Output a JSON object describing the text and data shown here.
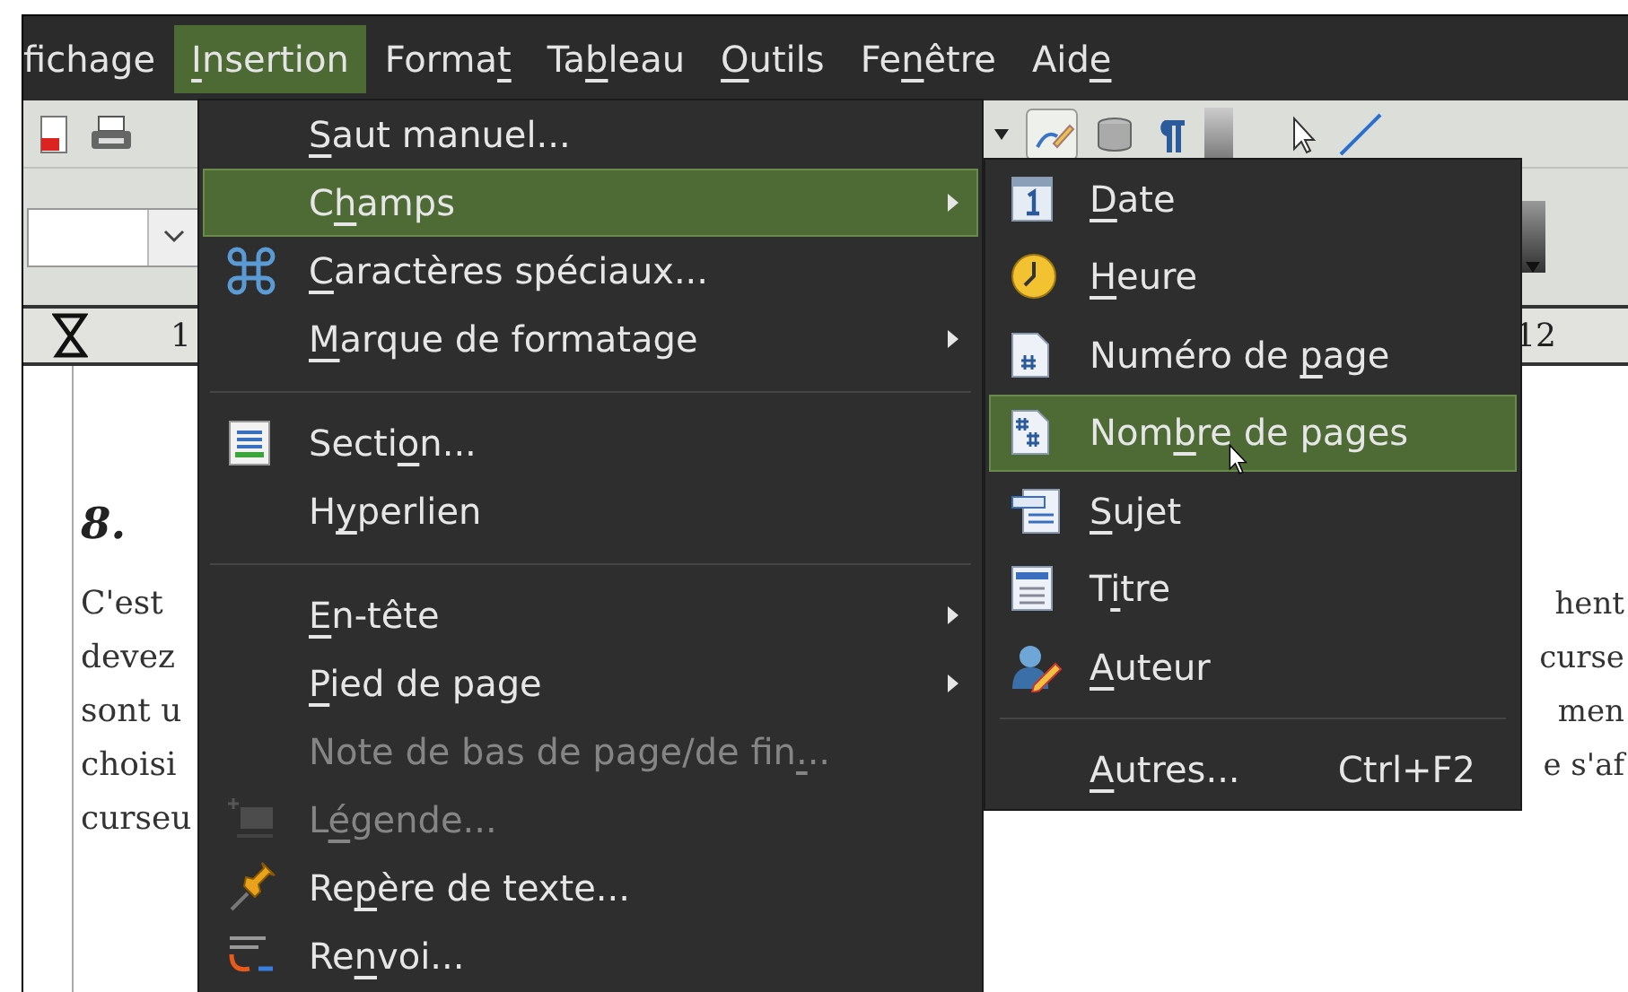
{
  "menubar": [
    {
      "label": [
        {
          "text": "fichage"
        }
      ],
      "selected": false
    },
    {
      "label": [
        {
          "text": "I",
          "underlined": true
        },
        {
          "text": "nsertion"
        }
      ],
      "selected": true
    },
    {
      "label": [
        {
          "text": "Forma"
        },
        {
          "text": "t",
          "underlined": true
        }
      ],
      "selected": false
    },
    {
      "label": [
        {
          "text": "Ta"
        },
        {
          "text": "b",
          "underlined": true
        },
        {
          "text": "leau"
        }
      ],
      "selected": false
    },
    {
      "label": [
        {
          "text": "O",
          "underlined": true
        },
        {
          "text": "utils"
        }
      ],
      "selected": false
    },
    {
      "label": [
        {
          "text": "Fe"
        },
        {
          "text": "n",
          "underlined": true
        },
        {
          "text": "être"
        }
      ],
      "selected": false
    },
    {
      "label": [
        {
          "text": "Aid"
        },
        {
          "text": "e",
          "underlined": true
        }
      ],
      "selected": false
    }
  ],
  "ruler": {
    "labels": [
      "1",
      "12"
    ]
  },
  "document": {
    "heading": "8.",
    "left_lines": [
      "C'est",
      "devez",
      "sont u",
      "choisi",
      "curseu"
    ],
    "right_lines": [
      "hent",
      "curse",
      "men",
      "e s'af"
    ]
  },
  "insert_menu": {
    "items": [
      {
        "kind": "item",
        "label": [
          {
            "text": "S",
            "underlined": true
          },
          {
            "text": "aut manuel..."
          }
        ],
        "selected": false,
        "disabled": false,
        "submenu": false
      },
      {
        "kind": "item",
        "label": [
          {
            "text": "C"
          },
          {
            "text": "h",
            "underlined": true
          },
          {
            "text": "amps"
          }
        ],
        "selected": true,
        "disabled": false,
        "submenu": true
      },
      {
        "kind": "item",
        "label": [
          {
            "text": "C",
            "underlined": true
          },
          {
            "text": "aractères spéciaux..."
          }
        ],
        "selected": false,
        "disabled": false,
        "submenu": false
      },
      {
        "kind": "item",
        "label": [
          {
            "text": "M",
            "underlined": true
          },
          {
            "text": "arque de formatage"
          }
        ],
        "selected": false,
        "disabled": false,
        "submenu": true
      },
      {
        "kind": "separator"
      },
      {
        "kind": "item",
        "label": [
          {
            "text": "Secti"
          },
          {
            "text": "o",
            "underlined": true
          },
          {
            "text": "n..."
          }
        ],
        "selected": false,
        "disabled": false,
        "submenu": false
      },
      {
        "kind": "item",
        "label": [
          {
            "text": "H"
          },
          {
            "text": "y",
            "underlined": true
          },
          {
            "text": "perlien"
          }
        ],
        "selected": false,
        "disabled": false,
        "submenu": false
      },
      {
        "kind": "separator"
      },
      {
        "kind": "item",
        "label": [
          {
            "text": "E",
            "underlined": true
          },
          {
            "text": "n-tête"
          }
        ],
        "selected": false,
        "disabled": false,
        "submenu": true
      },
      {
        "kind": "item",
        "label": [
          {
            "text": "P",
            "underlined": true
          },
          {
            "text": "ied de page"
          }
        ],
        "selected": false,
        "disabled": false,
        "submenu": true
      },
      {
        "kind": "item",
        "label": [
          {
            "text": "Note de bas de page/de fin"
          },
          {
            "text": ".",
            "underlined": true
          },
          {
            "text": ".."
          }
        ],
        "selected": false,
        "disabled": true,
        "submenu": false
      },
      {
        "kind": "item",
        "label": [
          {
            "text": "L"
          },
          {
            "text": "é",
            "underlined": true
          },
          {
            "text": "gende..."
          }
        ],
        "selected": false,
        "disabled": true,
        "submenu": false
      },
      {
        "kind": "item",
        "label": [
          {
            "text": "Re"
          },
          {
            "text": "p",
            "underlined": true
          },
          {
            "text": "ère de texte..."
          }
        ],
        "selected": false,
        "disabled": false,
        "submenu": false
      },
      {
        "kind": "item",
        "label": [
          {
            "text": "Re"
          },
          {
            "text": "n",
            "underlined": true
          },
          {
            "text": "voi..."
          }
        ],
        "selected": false,
        "disabled": false,
        "submenu": false
      }
    ]
  },
  "fields_submenu": {
    "items": [
      {
        "kind": "item",
        "label": [
          {
            "text": "D",
            "underlined": true
          },
          {
            "text": "ate"
          }
        ],
        "selected": false
      },
      {
        "kind": "item",
        "label": [
          {
            "text": "H",
            "underlined": true
          },
          {
            "text": "eure"
          }
        ],
        "selected": false
      },
      {
        "kind": "item",
        "label": [
          {
            "text": "Numéro de "
          },
          {
            "text": "p",
            "underlined": true
          },
          {
            "text": "age"
          }
        ],
        "selected": false
      },
      {
        "kind": "item",
        "label": [
          {
            "text": "Nom"
          },
          {
            "text": "b",
            "underlined": true
          },
          {
            "text": "re de pages"
          }
        ],
        "selected": true
      },
      {
        "kind": "item",
        "label": [
          {
            "text": "S",
            "underlined": true
          },
          {
            "text": "ujet"
          }
        ],
        "selected": false
      },
      {
        "kind": "item",
        "label": [
          {
            "text": "T"
          },
          {
            "text": "i",
            "underlined": true
          },
          {
            "text": "tre"
          }
        ],
        "selected": false
      },
      {
        "kind": "item",
        "label": [
          {
            "text": "A",
            "underlined": true
          },
          {
            "text": "uteur"
          }
        ],
        "selected": false
      },
      {
        "kind": "separator"
      },
      {
        "kind": "item",
        "label": [
          {
            "text": "A",
            "underlined": true
          },
          {
            "text": "utres..."
          }
        ],
        "shortcut": "Ctrl+F2",
        "selected": false
      }
    ]
  }
}
